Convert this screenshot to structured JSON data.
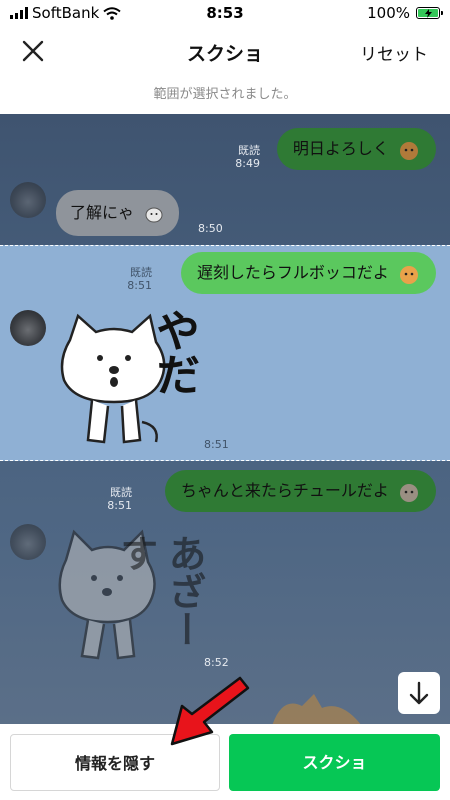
{
  "status": {
    "carrier": "SoftBank",
    "time": "8:53",
    "battery": "100%"
  },
  "header": {
    "title": "スクショ",
    "reset_label": "リセット",
    "subtitle": "範囲が選択されました。"
  },
  "messages": [
    {
      "text": "明日よろしく",
      "read": "既読",
      "time": "8:49"
    },
    {
      "text": "了解にゃ",
      "time": "8:50"
    },
    {
      "text": "遅刻したらフルボッコだよ",
      "read": "既読",
      "time": "8:51"
    },
    {
      "sticker_text": "やだ",
      "time": "8:51"
    },
    {
      "text": "ちゃんと来たらチュールだよ",
      "read": "既読",
      "time": "8:51"
    },
    {
      "sticker_text": "あざーす",
      "time": "8:52"
    }
  ],
  "buttons": {
    "hide_info": "情報を隠す",
    "screenshot": "スクショ"
  },
  "colors": {
    "accent": "#06c755",
    "selection": "#8fb0d4",
    "pointer_arrow": "#e8141b"
  },
  "icons": [
    "close-icon",
    "wifi-icon",
    "battery-icon",
    "arrow-down-icon",
    "red-pointer-arrow"
  ]
}
